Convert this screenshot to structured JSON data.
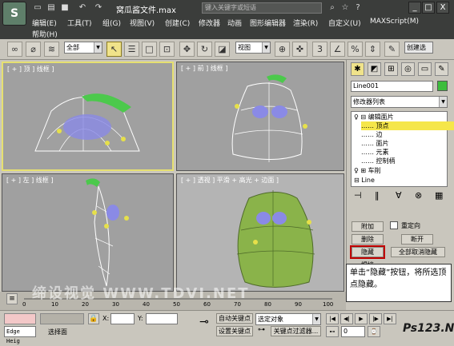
{
  "titlebar": {
    "logo": "S",
    "title": "窝瓜酱文件.max",
    "search_placeholder": "键入关键字或短语",
    "minimize": "_",
    "maximize": "□",
    "close": "X"
  },
  "menus": {
    "row1": [
      "编辑(E)",
      "工具(T)",
      "组(G)",
      "视图(V)",
      "创建(C)",
      "修改器",
      "动画",
      "图形编辑器",
      "渲染(R)",
      "自定义(U)",
      "MAXScript(M)"
    ],
    "row2": [
      "帮助(H)"
    ]
  },
  "toolbar": {
    "selection_filter": "全部",
    "coord_system": "视图",
    "create_selection_set": "创建选"
  },
  "viewports": {
    "top": "[ + ] 顶 ] 线框 ]",
    "front": "[ + ] 前 ] 线框 ]",
    "left": "[ + ] 左 ] 线框 ]",
    "perspective": "[ + ] 透视 ] 平滑 + 高光 + 边面 ]"
  },
  "panel": {
    "object_name": "Line001",
    "object_color": "#3dbd3d",
    "modifier_list": "修改器列表",
    "stack": {
      "edit_patch": "编辑面片",
      "vertex": "顶点",
      "edge": "边",
      "patch": "面片",
      "element": "元素",
      "handle": "控制柄",
      "lathe": "车削",
      "line": "Line",
      "line_sub": "顶点"
    },
    "buttons": {
      "attach": "附加",
      "reorient": "重定向",
      "delete": "删除",
      "break": "断开",
      "hide": "隐藏",
      "unhide_all": "全部取消隐藏"
    },
    "rollout": "焊接"
  },
  "callout": {
    "text": "单击“隐藏”按钮，将所选顶点隐藏。"
  },
  "timeline": {
    "ticks": [
      "0",
      "10",
      "20",
      "30",
      "40",
      "50",
      "60",
      "70",
      "80",
      "90",
      "100"
    ],
    "watermark": "缔设视觉 WWW.TDVI.NET"
  },
  "statusbar": {
    "script_field": "Edge Heig",
    "prompt": "选择面",
    "x_label": "X:",
    "y_label": "Y:",
    "autokey": "自动关键点",
    "selected_object": "选定对象",
    "set_key": "设置关键点",
    "key_filter": "关键点过滤器...",
    "frame": "0",
    "brand": "Ps123.Net"
  },
  "colors": {
    "ui_bg": "#c9c6bd",
    "titlebar": "#3b3d3b",
    "viewport": "#a0a0a0",
    "active_viewport": "#e6e070",
    "selection_highlight": "#f5e64a",
    "callout_border": "#c00000"
  }
}
